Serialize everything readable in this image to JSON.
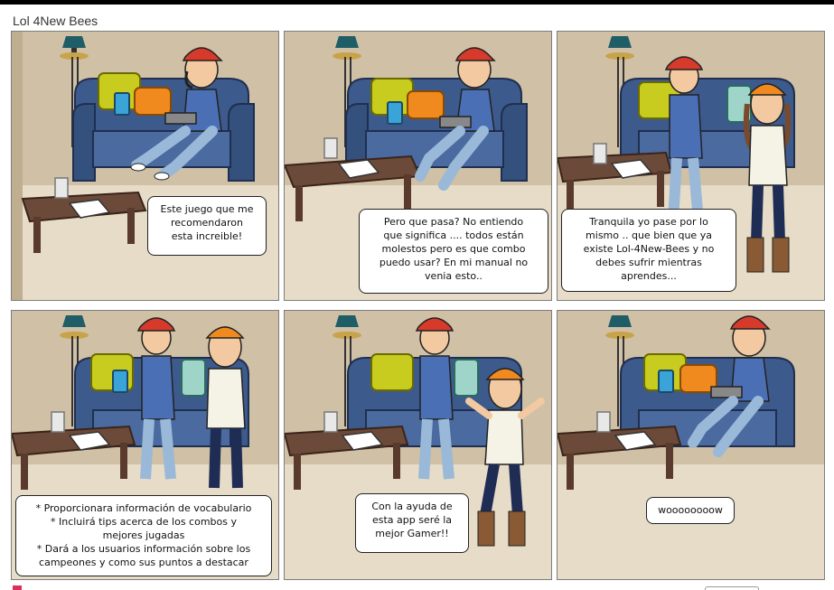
{
  "app": {
    "title": "Lol 4New Bees"
  },
  "colors": {
    "wall": "#cfc0a6",
    "floor": "#e6dcc7",
    "sofa": "#3d5a8c",
    "table": "#6b4a3a",
    "cap": "#d63a2a",
    "beanie": "#f08a1e",
    "shirt_boy": "#4b6fb5",
    "shirt_girl": "#f5f2e6"
  },
  "panels": [
    {
      "id": 1,
      "bubble": "Este juego que me\nrecomendaron\nesta increible!"
    },
    {
      "id": 2,
      "bubble": "Pero que pasa?  No entiendo\nque significa .... todos están\nmolestos pero es que combo\npuedo usar? En mi manual no\nvenia esto.."
    },
    {
      "id": 3,
      "bubble": "Tranquila yo pase por lo\nmismo .. que bien que  ya\nexiste Lol-4New-Bees y no\ndebes sufrir mientras\naprendes..."
    },
    {
      "id": 4,
      "bubble": "* Proporcionara información de vocabulario\n* Incluirá tips acerca de los combos y\nmejores jugadas\n* Dará a los usuarios información sobre los\ncampeones y como sus puntos a destacar"
    },
    {
      "id": 5,
      "bubble": "Con la ayuda de\nesta app seré la\nmejor Gamer!!"
    },
    {
      "id": 6,
      "bubble": "woooooooow"
    }
  ]
}
